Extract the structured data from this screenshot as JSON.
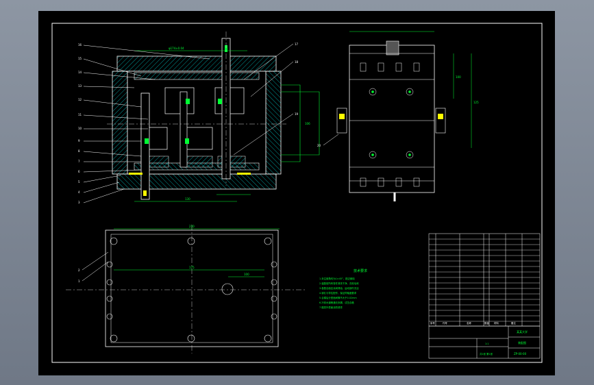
{
  "drawing": {
    "title": "",
    "part_numbers_left": [
      "16",
      "15",
      "14",
      "13",
      "12",
      "11",
      "10",
      "9",
      "8",
      "7",
      "6",
      "5",
      "4",
      "3"
    ],
    "part_numbers_right": [
      "17",
      "18",
      "19"
    ],
    "side_view_label": "20",
    "plan_view_labels": [
      "2",
      "1"
    ],
    "dimension_labels": [
      "φ174±0.04",
      "130",
      "106",
      "100",
      "125",
      "230",
      "175",
      "100"
    ],
    "tech_requirements": {
      "title": "技术要求",
      "lines": [
        "1.未注倒角均为1×45°，锐边倒钝",
        "2.装配前所有零件清洗干净，去除毛刺",
        "3.各配合面应涂润滑油，运动部件灵活",
        "4.销孔与导柱配作，保证同轴度要求",
        "5.合模后分型面间隙不大于0.02mm",
        "6.冷却水道畅通无渗漏，试压合格",
        "7.模具外表面涂防锈漆"
      ]
    },
    "title_block": {
      "company": "某某大学",
      "drawing_name": "装配图",
      "drawing_no": "ZP-00-00",
      "scale": "1:1",
      "sheet": "共1张 第1张"
    },
    "bom_header": [
      "序号",
      "代号",
      "名称",
      "数量",
      "材料",
      "备注"
    ]
  },
  "colors": {
    "background": "#000000",
    "line": "#ffffff",
    "hatch": "#00c0c0",
    "green": "#00ff33",
    "yellow": "#ffff00",
    "border": "#ffffff"
  }
}
